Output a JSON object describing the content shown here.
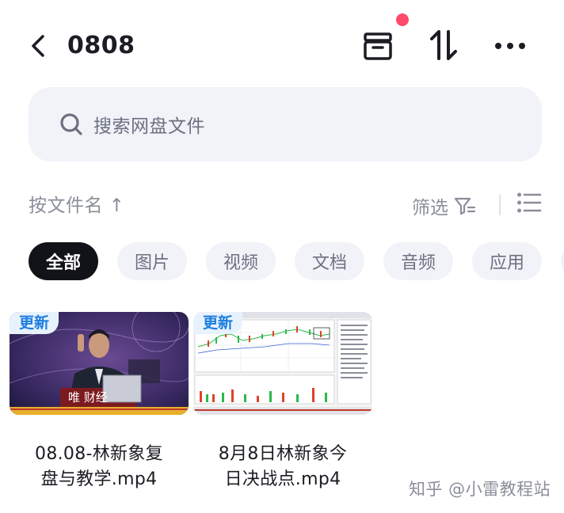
{
  "header": {
    "title": "0808",
    "back_icon": "chevron-left-icon",
    "archive_icon": "archive-box-icon",
    "sort_icon": "sort-arrows-icon",
    "more_icon": "more-horizontal-icon",
    "badge_color": "#ff4a6b"
  },
  "search": {
    "placeholder": "搜索网盘文件",
    "icon": "search-icon"
  },
  "sortbar": {
    "sort_label": "按文件名 ↑",
    "filter_label": "筛选",
    "filter_icon": "filter-icon",
    "view_icon": "list-view-icon"
  },
  "chips": [
    {
      "label": "全部",
      "active": true
    },
    {
      "label": "图片"
    },
    {
      "label": "视频"
    },
    {
      "label": "文档"
    },
    {
      "label": "音频"
    },
    {
      "label": "应用"
    }
  ],
  "files": [
    {
      "badge": "更新",
      "name_line1": "08.08-林新象复",
      "name_line2": "盘与教学.mp4",
      "thumb_caption": "唯 财经"
    },
    {
      "badge": "更新",
      "name_line1": "8月8日林新象今",
      "name_line2": "日决战点.mp4"
    }
  ],
  "watermark": "知乎 @小雷教程站",
  "colors": {
    "accent": "#1b7de0",
    "chip_active": "#111318",
    "chip_bg": "#f1f3f9"
  }
}
